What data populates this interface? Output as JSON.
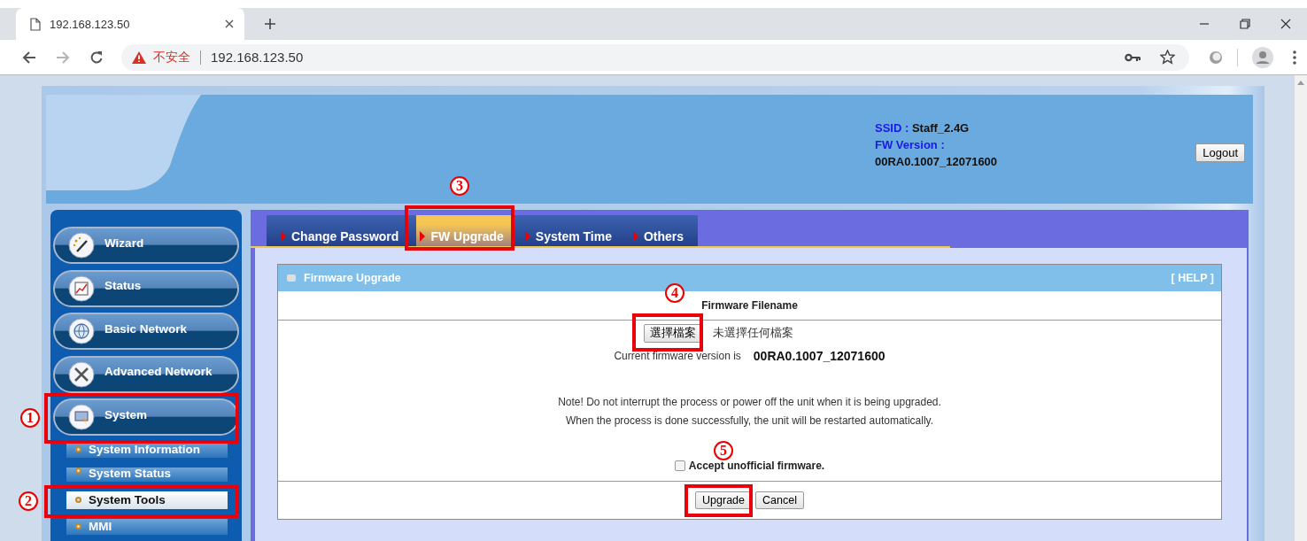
{
  "browser": {
    "tab_title": "192.168.123.50",
    "security_label": "不安全",
    "url": "192.168.123.50",
    "forward_disabled": true
  },
  "header": {
    "ssid_label": "SSID :",
    "ssid": "Staff_2.4G",
    "fw_label": "FW Version :",
    "fw_version": "00RA0.1007_12071600",
    "logout": "Logout"
  },
  "nav": {
    "items": [
      {
        "label": "Wizard"
      },
      {
        "label": "Status"
      },
      {
        "label": "Basic Network"
      },
      {
        "label": "Advanced Network"
      },
      {
        "label": "System"
      }
    ],
    "subitems": [
      {
        "label": "System Information",
        "selected": false
      },
      {
        "label": "System Status",
        "selected": false
      },
      {
        "label": "System Tools",
        "selected": true
      },
      {
        "label": "MMI",
        "selected": false
      }
    ]
  },
  "tabs": [
    {
      "label": "Change Password",
      "selected": false
    },
    {
      "label": "FW Upgrade",
      "selected": true
    },
    {
      "label": "System Time",
      "selected": false
    },
    {
      "label": "Others",
      "selected": false
    }
  ],
  "firmware": {
    "title": "Firmware Upgrade",
    "help": "[ HELP ]",
    "filename_heading": "Firmware Filename",
    "choose_button": "選擇檔案",
    "no_file": "未選擇任何檔案",
    "current_label": "Current firmware version is",
    "current_version": "00RA0.1007_12071600",
    "notes": [
      "Note! Do not interrupt the process or power off the unit when it is being upgraded.",
      "When the process is done successfully, the unit will be restarted automatically."
    ],
    "accept_label": "Accept unofficial firmware.",
    "accept_checked": false,
    "buttons": [
      "Upgrade",
      "Cancel"
    ]
  },
  "annotations": [
    {
      "label": "1"
    },
    {
      "label": "2"
    },
    {
      "label": "3"
    },
    {
      "label": "4"
    },
    {
      "label": "5"
    }
  ]
}
